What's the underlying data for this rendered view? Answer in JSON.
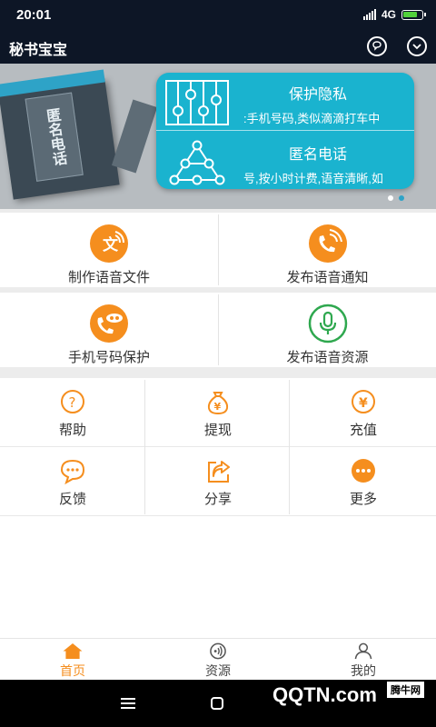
{
  "status": {
    "time": "20:01",
    "network": "4G"
  },
  "app": {
    "title": "秘书宝宝"
  },
  "banner": {
    "book_text": "匿名电话",
    "feature1_title": "保护隐私",
    "feature1_desc": ":手机号码,类似滴滴打车中",
    "feature2_title": "匿名电话",
    "feature2_desc": "号,按小时计费,语音清晰,如"
  },
  "actions": {
    "make_voice_file": "制作语音文件",
    "publish_voice_notice": "发布语音通知",
    "phone_protect": "手机号码保护",
    "publish_voice_resource": "发布语音资源"
  },
  "grid": {
    "help": "帮助",
    "withdraw": "提现",
    "recharge": "充值",
    "feedback": "反馈",
    "share": "分享",
    "more": "更多"
  },
  "tabs": {
    "home": "首页",
    "resources": "资源",
    "mine": "我的"
  },
  "watermark": {
    "brand": "QQTN.com",
    "site": "腾牛网"
  },
  "colors": {
    "accent": "#f58e1e",
    "green": "#2fa84f",
    "banner_card": "#1ab3cf",
    "dark_bar": "#0d1626"
  }
}
